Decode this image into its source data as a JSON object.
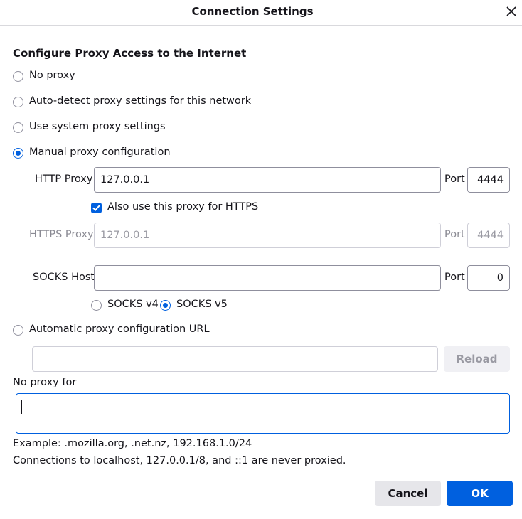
{
  "window": {
    "title": "Connection Settings"
  },
  "section": {
    "heading": "Configure Proxy Access to the Internet"
  },
  "options": {
    "no_proxy": "No proxy",
    "auto_detect": "Auto-detect proxy settings for this network",
    "system": "Use system proxy settings",
    "manual": "Manual proxy configuration",
    "auto_url": "Automatic proxy configuration URL"
  },
  "manual": {
    "http_label": "HTTP Proxy",
    "http_value": "127.0.0.1",
    "port_label": "Port",
    "http_port": "4444",
    "also_https_label": "Also use this proxy for HTTPS",
    "https_label": "HTTPS Proxy",
    "https_value": "127.0.0.1",
    "https_port": "4444",
    "socks_label": "SOCKS Host",
    "socks_value": "",
    "socks_port": "0",
    "socks_v4": "SOCKS v4",
    "socks_v5": "SOCKS v5"
  },
  "auto_url": {
    "value": "",
    "reload_label": "Reload"
  },
  "no_proxy_for": {
    "label": "No proxy for",
    "value": "",
    "example": "Example: .mozilla.org, .net.nz, 192.168.1.0/24",
    "note": "Connections to localhost, 127.0.0.1/8, and ::1 are never proxied."
  },
  "buttons": {
    "cancel": "Cancel",
    "ok": "OK"
  },
  "colors": {
    "accent": "#0060df",
    "border": "#8f8f9d"
  },
  "selected": {
    "proxy_mode": "manual",
    "socks_version": "v5",
    "also_https": true
  }
}
